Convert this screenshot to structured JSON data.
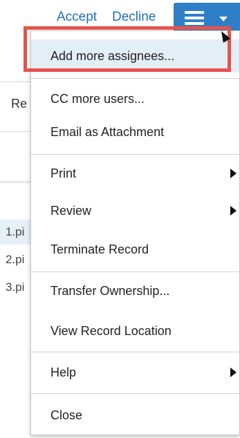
{
  "toolbar": {
    "accept_label": "Accept",
    "decline_label": "Decline",
    "menu_button_icon": "hamburger-menu-icon",
    "colors": {
      "link": "#1e6fb7",
      "menu_button": "#2e7fc6",
      "highlight_border": "#e5534b",
      "highlight_bg": "#e4eef6"
    }
  },
  "background": {
    "column_header": "Re",
    "rows": [
      "1.pi",
      "2.pi",
      "3.pi"
    ]
  },
  "menu": {
    "items": [
      {
        "label": "Add more assignees...",
        "submenu": false,
        "highlighted": true
      },
      {
        "label": "CC more users...",
        "submenu": false
      },
      {
        "label": "Email as Attachment",
        "submenu": false
      },
      {
        "label": "Print",
        "submenu": true
      },
      {
        "label": "Review",
        "submenu": true
      },
      {
        "label": "Terminate Record",
        "submenu": false
      },
      {
        "label": "Transfer Ownership...",
        "submenu": false
      },
      {
        "label": "View Record Location",
        "submenu": false
      },
      {
        "label": "Help",
        "submenu": true
      },
      {
        "label": "Close",
        "submenu": false
      }
    ]
  }
}
